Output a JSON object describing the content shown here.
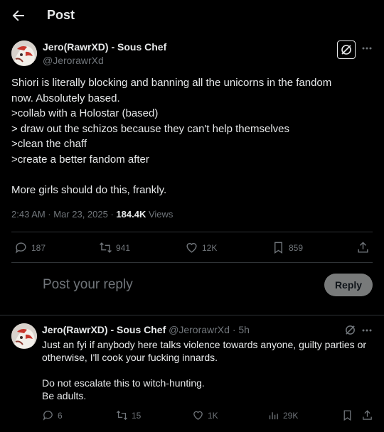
{
  "header": {
    "title": "Post"
  },
  "post": {
    "author_name": "Jero(RawrXD) - Sous Chef",
    "author_handle": "@JerorawrXd",
    "body_lines": [
      "Shiori is literally blocking and banning all the unicorns in the fandom",
      "now. Absolutely based.",
      ">collab with a Holostar (based)",
      "> draw out the schizos because they can't help themselves",
      ">clean the chaff",
      ">create a better fandom after",
      "",
      "More girls should do this, frankly."
    ],
    "timestamp": "2:43 AM · Mar 23, 2025 ·",
    "views_count": "184.4K",
    "views_label": "Views",
    "actions": {
      "replies": "187",
      "reposts": "941",
      "likes": "12K",
      "bookmarks": "859"
    }
  },
  "composer": {
    "placeholder": "Post your reply",
    "button": "Reply"
  },
  "reply": {
    "author_name": "Jero(RawrXD) - Sous Chef",
    "author_handle": "@JerorawrXd",
    "time": "· 5h",
    "body_lines": [
      "Just an fyi if anybody here talks violence towards anyone, guilty parties or",
      "otherwise, I'll cook your fucking innards.",
      "",
      "Do not escalate this to witch-hunting.",
      "Be adults."
    ],
    "actions": {
      "replies": "6",
      "reposts": "15",
      "likes": "1K",
      "views": "29K"
    }
  },
  "colors": {
    "background": "#000000",
    "text": "#e7e9ea",
    "muted": "#71767b",
    "divider": "#2f3336",
    "reply_button": "#787a7a"
  },
  "icons": [
    "back-arrow-icon",
    "grok-icon",
    "more-icon",
    "reply-icon",
    "repost-icon",
    "like-icon",
    "bookmark-icon",
    "share-icon",
    "views-icon"
  ]
}
